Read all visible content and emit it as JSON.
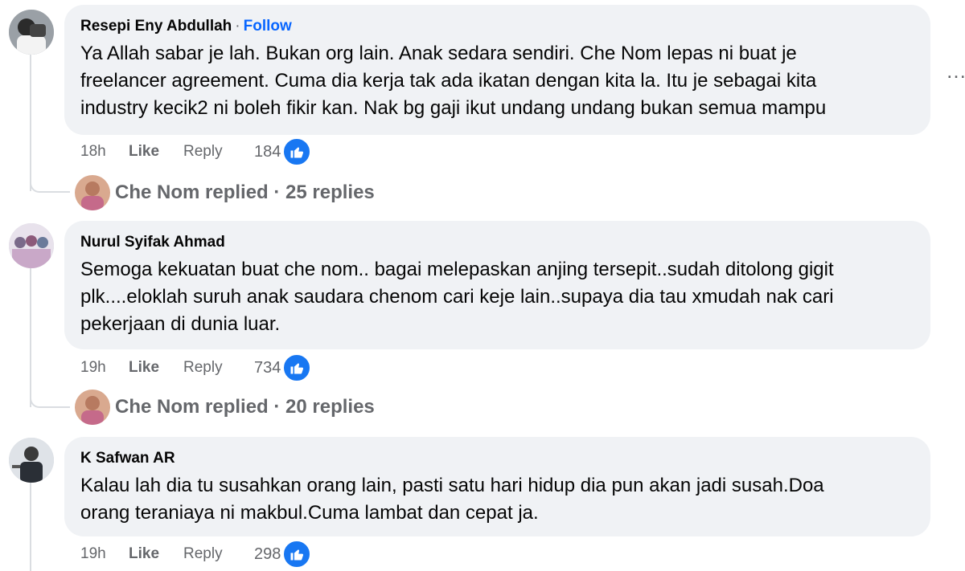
{
  "comments": [
    {
      "author": "Resepi Eny Abdullah",
      "separator": "·",
      "follow_label": "Follow",
      "text": "Ya Allah sabar je lah. Bukan org lain. Anak sedara sendiri. Che Nom lepas ni buat je\nfreelancer agreement. Cuma dia kerja tak ada ikatan dengan kita la. Itu je sebagai kita\nindustry kecik2 ni boleh fikir kan. Nak bg gaji ikut undang undang bukan semua mampu",
      "time": "18h",
      "like_label": "Like",
      "reply_label": "Reply",
      "reaction_count": "184",
      "replies_text": "Che Nom replied · 25 replies"
    },
    {
      "author": "Nurul Syifak Ahmad",
      "text": "Semoga kekuatan buat che nom.. bagai melepaskan anjing tersepit..sudah ditolong gigit\nplk....eloklah suruh anak saudara chenom cari keje lain..supaya dia tau xmudah nak cari\npekerjaan di dunia luar.",
      "time": "19h",
      "like_label": "Like",
      "reply_label": "Reply",
      "reaction_count": "734",
      "replies_text": "Che Nom replied · 20 replies"
    },
    {
      "author": "K Safwan AR",
      "text": "Kalau lah dia tu susahkan orang lain, pasti satu hari hidup dia pun akan jadi susah.Doa\norang teraniaya ni makbul.Cuma lambat dan cepat ja.",
      "time": "19h",
      "like_label": "Like",
      "reply_label": "Reply",
      "reaction_count": "298"
    }
  ],
  "more_icon": "…",
  "colors": {
    "bubble": "#f0f2f5",
    "accent": "#0866ff",
    "like_badge": "#1877f2",
    "muted": "#65676b"
  }
}
